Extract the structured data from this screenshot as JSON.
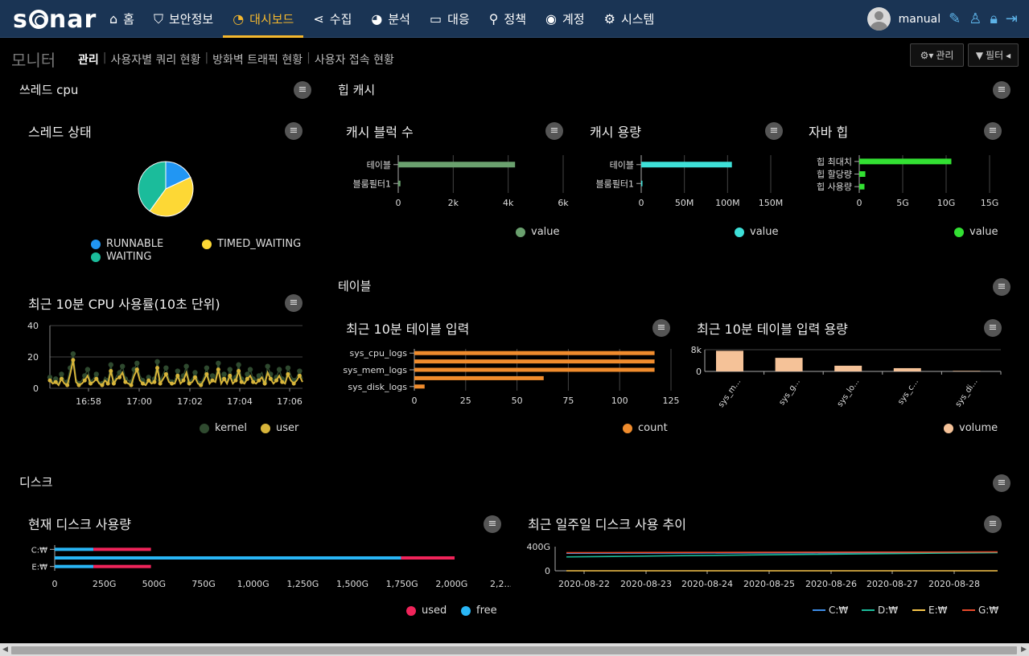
{
  "logo": "sonar",
  "nav": [
    {
      "icon": "home-icon",
      "glyph": "⌂",
      "label": "홈"
    },
    {
      "icon": "shield-icon",
      "glyph": "⛉",
      "label": "보안정보"
    },
    {
      "icon": "dashboard-icon",
      "glyph": "◔",
      "label": "대시보드",
      "active": true
    },
    {
      "icon": "share-icon",
      "glyph": "⋖",
      "label": "수집"
    },
    {
      "icon": "pie-chart-icon",
      "glyph": "◕",
      "label": "분석"
    },
    {
      "icon": "laptop-icon",
      "glyph": "▭",
      "label": "대응"
    },
    {
      "icon": "search-icon",
      "glyph": "⚲",
      "label": "정책"
    },
    {
      "icon": "account-icon",
      "glyph": "◉",
      "label": "계정"
    },
    {
      "icon": "gear-icon",
      "glyph": "⚙",
      "label": "시스템"
    }
  ],
  "user": {
    "name": "manual"
  },
  "subbar": {
    "title": "모니터",
    "tabs": [
      "관리",
      "사용자별 쿼리 현황",
      "방화벽 트래픽 현황",
      "사용자 접속 현황"
    ],
    "manage_label": "관리",
    "filter_label": "필터"
  },
  "sections": {
    "thread_cpu": "쓰레드 cpu",
    "heap_cache": "힙 캐시",
    "table": "테이블",
    "disk": "디스크"
  },
  "cards": {
    "thread_state": "스레드 상태",
    "cpu_usage": "최근 10분 CPU 사용률(10초 단위)",
    "cache_blocks": "캐시 블럭 수",
    "cache_size": "캐시 용량",
    "java_heap": "자바 힙",
    "table_input": "최근 10분 테이블 입력",
    "table_volume": "최근 10분 테이블 입력 용량",
    "disk_now": "현재 디스크 사용량",
    "disk_week": "최근 일주일 디스크 사용 추이"
  },
  "colors": {
    "runnable": "#2196f3",
    "timed_waiting": "#fdd835",
    "waiting": "#1bbc9b",
    "kernel": "#2f4a2f",
    "user": "#d8b53a",
    "cache_blocks": "#6aa06e",
    "cache_size": "#3ee0d8",
    "heap": "#33e033",
    "count": "#f08c2d",
    "volume": "#f5c298",
    "used": "#f0245a",
    "free": "#29b6f6",
    "c": "#3d8de8",
    "d": "#1bbc9b",
    "e": "#f7c64a",
    "g": "#e84a2b"
  },
  "chart_data": [
    {
      "id": "thread_state",
      "type": "pie",
      "series": [
        {
          "name": "RUNNABLE",
          "value": 18
        },
        {
          "name": "TIMED_WAITING",
          "value": 42
        },
        {
          "name": "WAITING",
          "value": 40
        }
      ]
    },
    {
      "id": "cpu",
      "type": "line",
      "ylim": [
        0,
        40
      ],
      "yticks": [
        "40",
        "20",
        "0"
      ],
      "xticks": [
        "16:58",
        "17:00",
        "17:02",
        "17:04",
        "17:06"
      ],
      "series": [
        {
          "name": "kernel",
          "values": [
            7,
            4,
            6,
            3,
            9,
            5,
            4,
            13,
            22,
            6,
            3,
            5,
            8,
            12,
            4,
            6,
            9,
            4,
            3,
            7,
            5,
            15,
            4,
            8,
            10,
            14,
            6,
            5,
            4,
            12,
            16,
            8,
            5,
            3,
            7,
            4,
            6,
            17,
            5,
            9,
            13,
            6,
            4,
            5,
            11,
            5,
            8,
            14,
            4,
            6,
            10,
            5,
            3,
            7,
            13,
            4,
            8,
            6,
            16,
            5,
            9,
            4,
            12,
            5,
            7,
            15,
            6,
            4,
            9,
            12,
            6,
            5,
            8,
            10,
            4,
            14,
            9,
            5,
            7,
            12,
            6,
            4,
            13,
            8,
            5,
            7,
            11,
            6
          ]
        },
        {
          "name": "user",
          "values": [
            5,
            3,
            4,
            2,
            6,
            3,
            2,
            9,
            18,
            4,
            2,
            3,
            5,
            8,
            3,
            4,
            6,
            3,
            2,
            5,
            3,
            11,
            3,
            6,
            7,
            10,
            4,
            3,
            2,
            8,
            12,
            5,
            3,
            2,
            5,
            3,
            4,
            13,
            3,
            6,
            9,
            4,
            3,
            3,
            8,
            3,
            5,
            10,
            3,
            4,
            7,
            3,
            2,
            5,
            9,
            3,
            5,
            4,
            12,
            3,
            6,
            3,
            8,
            3,
            5,
            11,
            4,
            3,
            6,
            8,
            4,
            3,
            5,
            7,
            3,
            10,
            6,
            3,
            5,
            8,
            4,
            3,
            9,
            5,
            3,
            5,
            8,
            4
          ]
        }
      ]
    },
    {
      "id": "cache_blocks",
      "type": "bar",
      "orientation": "horizontal",
      "categories": [
        "테이블",
        "블룸필터1"
      ],
      "values": [
        4250,
        80
      ],
      "xlim": [
        0,
        6000
      ],
      "xticks": [
        "0",
        "2k",
        "4k",
        "6k"
      ],
      "series": [
        {
          "name": "value"
        }
      ]
    },
    {
      "id": "cache_size",
      "type": "bar",
      "orientation": "horizontal",
      "categories": [
        "테이블",
        "블룸필터1"
      ],
      "values": [
        105,
        0
      ],
      "xlim": [
        0,
        150
      ],
      "xticks": [
        "0",
        "50M",
        "100M",
        "150M"
      ],
      "series": [
        {
          "name": "value"
        }
      ]
    },
    {
      "id": "java_heap",
      "type": "bar",
      "orientation": "horizontal",
      "categories": [
        "힙 최대치",
        "힙 할당량",
        "힙 사용량"
      ],
      "values": [
        10.6,
        0.7,
        0.6
      ],
      "xlim": [
        0,
        15
      ],
      "xticks": [
        "0",
        "5G",
        "10G",
        "15G"
      ],
      "series": [
        {
          "name": "value"
        }
      ]
    },
    {
      "id": "table_input",
      "type": "bar",
      "orientation": "horizontal",
      "categories": [
        "sys_cpu_logs",
        "",
        "sys_mem_logs",
        "",
        "sys_disk_logs"
      ],
      "tick_labels": [
        "sys_cpu_logs",
        "sys_mem_logs",
        "sys_disk_logs"
      ],
      "values": [
        117,
        117,
        117,
        63,
        5
      ],
      "xlim": [
        0,
        125
      ],
      "xticks": [
        "0",
        "25",
        "50",
        "75",
        "100",
        "125"
      ],
      "series": [
        {
          "name": "count"
        }
      ]
    },
    {
      "id": "table_volume",
      "type": "bar",
      "categories": [
        "sys_m...",
        "sys_g...",
        "sys_lo...",
        "sys_c...",
        "sys_di..."
      ],
      "values": [
        7600,
        5000,
        2100,
        1200,
        200
      ],
      "ylim": [
        0,
        8000
      ],
      "yticks": [
        "8k",
        "0"
      ],
      "series": [
        {
          "name": "volume"
        }
      ]
    },
    {
      "id": "disk_now",
      "type": "bar",
      "orientation": "horizontal",
      "stacked": true,
      "categories": [
        "C:₩",
        "",
        "E:₩"
      ],
      "tick_labels": [
        "C:₩",
        "E:₩"
      ],
      "series": [
        {
          "name": "used",
          "values": [
            290,
            270,
            290
          ]
        },
        {
          "name": "free",
          "values": [
            195,
            1745,
            195
          ]
        }
      ],
      "xlim": [
        0,
        2250
      ],
      "xticks": [
        "0",
        "250G",
        "500G",
        "750G",
        "1,000G",
        "1,250G",
        "1,500G",
        "1,750G",
        "2,000G",
        "2,2..."
      ]
    },
    {
      "id": "disk_week",
      "type": "line",
      "ylim": [
        0,
        400
      ],
      "yticks": [
        "400G",
        "0"
      ],
      "xticks": [
        "2020-08-22",
        "2020-08-23",
        "2020-08-24",
        "2020-08-25",
        "2020-08-26",
        "2020-08-27",
        "2020-08-28"
      ],
      "series": [
        {
          "name": "C:₩",
          "values": [
            290,
            292,
            294,
            296,
            298,
            300,
            302,
            304
          ]
        },
        {
          "name": "D:₩",
          "values": [
            230,
            240,
            252,
            262,
            272,
            282,
            292,
            300
          ]
        },
        {
          "name": "E:₩",
          "values": [
            0,
            0,
            0,
            0,
            0,
            0,
            0,
            0
          ]
        },
        {
          "name": "G:₩",
          "values": [
            300,
            302,
            304,
            306,
            307,
            309,
            310,
            312
          ]
        }
      ]
    }
  ]
}
